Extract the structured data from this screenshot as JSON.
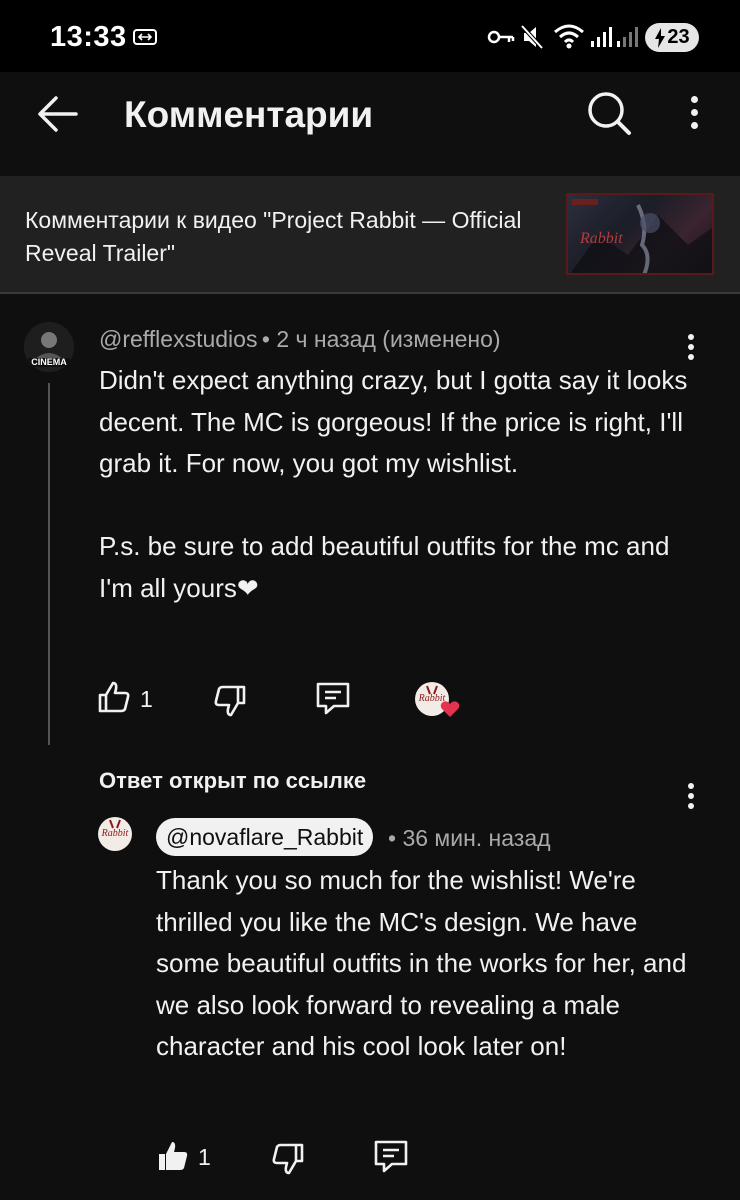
{
  "status_bar": {
    "time": "13:33",
    "battery": "23"
  },
  "app_bar": {
    "title": "Комментарии"
  },
  "video": {
    "title": "Комментарии к видео \"Project Rabbit — Official Reveal Trailer\""
  },
  "comment": {
    "author": "@refflexstudios",
    "meta": "• 2 ч назад (изменено)",
    "avatar_text": "CINEMA",
    "text": "Didn't expect anything crazy, but I gotta say it looks decent. The MC is gorgeous! If the price is right, I'll grab it. For now, you got my wishlist.\n\nP.s. be sure to add beautiful outfits for the mc and I'm all yours❤",
    "likes": "1",
    "creator_heart_avatar_text": "Rabbit"
  },
  "reply_section": {
    "label": "Ответ открыт по ссылке"
  },
  "reply": {
    "author": "@novaflare_Rabbit",
    "meta": "• 36 мин. назад",
    "avatar_text": "Rabbit",
    "text": "Thank you so much for the wishlist! We're thrilled you like the MC's design. We have some beautiful outfits in the works for her, and we also look forward to revealing a male character and his cool look later on!",
    "likes": "1"
  },
  "colors": {
    "background": "#0f0f0f",
    "header": "#212121",
    "secondary_text": "#aaaaaa",
    "heart": "#e33351"
  }
}
